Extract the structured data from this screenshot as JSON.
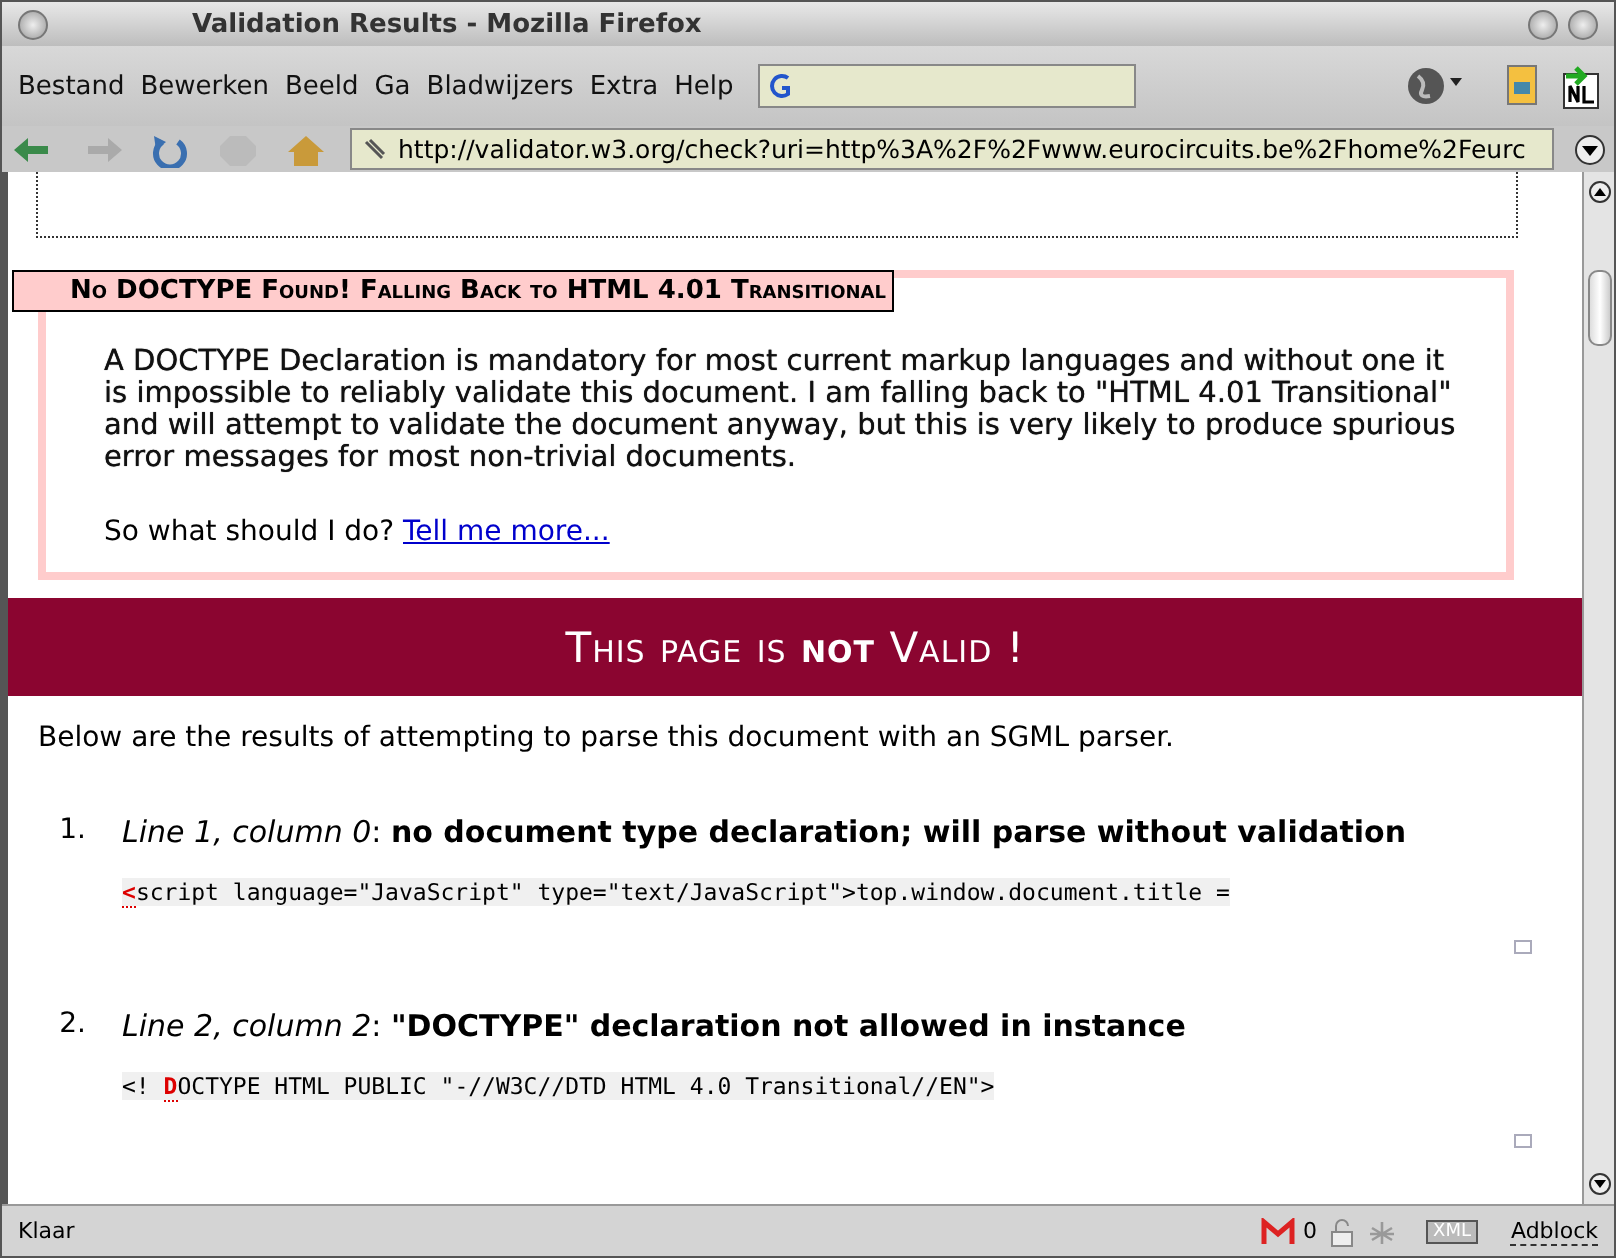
{
  "window": {
    "title": "Validation Results - Mozilla Firefox"
  },
  "menu": [
    "Bestand",
    "Bewerken",
    "Beeld",
    "Ga",
    "Bladwijzers",
    "Extra",
    "Help"
  ],
  "address": "http://validator.w3.org/check?uri=http%3A%2F%2Fwww.eurocircuits.be%2Fhome%2Feurc",
  "warning": {
    "title": "No DOCTYPE Found! Falling Back to HTML 4.01 Transitional",
    "body": "A DOCTYPE Declaration is mandatory for most current markup languages and without one it is impossible to reliably validate this document. I am falling back to \"HTML 4.01 Transitional\" and will attempt to validate the document anyway, but this is very likely to produce spurious error messages for most non-trivial documents.",
    "question": "So what should I do?",
    "link": "Tell me more..."
  },
  "banner": "This page is **not** Valid !",
  "intro": "Below are the results of attempting to parse this document with an SGML parser.",
  "errors": [
    {
      "number": "1.",
      "message": "*Line 1, column 0*: **no document type declaration; will parse without validation**",
      "code_mark": "<",
      "code_after": "script language=\"JavaScript\" type=\"text/JavaScript\">top.window.document.title ="
    },
    {
      "number": "2.",
      "message": "*Line 2, column 2*: **\"DOCTYPE\" declaration not allowed in instance**",
      "code_before": "<! ",
      "code_mark": "D",
      "code_after": "OCTYPE HTML PUBLIC \"-//W3C//DTD HTML 4.0 Transitional//EN\">"
    }
  ],
  "status": {
    "text": "Klaar",
    "mail_count": "0",
    "xml": "XML",
    "adblock": "Adblock"
  }
}
